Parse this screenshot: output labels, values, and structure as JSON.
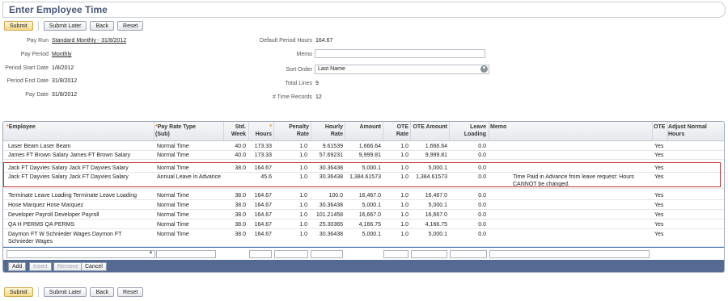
{
  "page_title": "Enter Employee Time",
  "buttons": {
    "submit": "Submit",
    "submit_later": "Submit Later",
    "back": "Back",
    "reset": "Reset"
  },
  "form_left": [
    {
      "label": "Pay Run",
      "value": "Standard Monthly - 31/8/2012"
    },
    {
      "label": "Pay Period",
      "value": "Monthly"
    },
    {
      "label": "Period Start Date",
      "value": "1/8/2012"
    },
    {
      "label": "Period End Date",
      "value": "31/8/2012"
    },
    {
      "label": "Pay Date",
      "value": "31/8/2012"
    }
  ],
  "form_right": {
    "default_hours_label": "Default Period Hours",
    "default_hours_value": "164.67",
    "memo_label": "Memo",
    "memo_value": "",
    "sort_order_label": "Sort Order",
    "sort_order_value": "Last Name",
    "total_lines_label": "Total Lines",
    "total_lines_value": "9",
    "time_records_label": "# Time Records",
    "time_records_value": "12"
  },
  "grid": {
    "headers": {
      "employee": "Employee",
      "pay_rate_type": "Pay Rate Type",
      "pay_rate_type_sub": "(Sub)",
      "std_week": "Std. Week",
      "hours": "Hours",
      "penalty_rate": "Penalty Rate",
      "hourly_rate": "Hourly Rate",
      "amount": "Amount",
      "ote_rate": "OTE Rate",
      "ote_amount": "OTE Amount",
      "leave_loading": "Leave Loading",
      "memo": "Memo",
      "ote": "OTE",
      "adjust": "Adjust Normal Hours"
    },
    "rows": [
      {
        "employee": "Laser Beam Laser Beam",
        "pay_rate_type": "Normal Time",
        "std_week": "40.0",
        "hours": "173.33",
        "penalty_rate": "1.0",
        "hourly_rate": "9.61539",
        "amount": "1,666.64",
        "ote_rate": "1.0",
        "ote_amount": "1,666.64",
        "leave_loading": "0.0",
        "memo": "",
        "ote": "Yes"
      },
      {
        "employee": "James FT Brown Salary James FT Brown Salary",
        "pay_rate_type": "Normal Time",
        "std_week": "40.0",
        "hours": "173.33",
        "penalty_rate": "1.0",
        "hourly_rate": "57.69231",
        "amount": "9,999.81",
        "ote_rate": "1.0",
        "ote_amount": "9,999.81",
        "leave_loading": "0.0",
        "memo": "",
        "ote": "Yes"
      },
      {
        "employee": "Jack FT Dayvies Salary Jack FT Dayvies Salary",
        "pay_rate_type": "Normal Time",
        "std_week": "38.0",
        "hours": "164.67",
        "penalty_rate": "1.0",
        "hourly_rate": "30.36438",
        "amount": "5,000.1",
        "ote_rate": "1.0",
        "ote_amount": "5,000.1",
        "leave_loading": "0.0",
        "memo": "",
        "ote": "Yes"
      },
      {
        "employee": "Jack FT Dayvies Salary Jack FT Dayvies Salary",
        "pay_rate_type": "Annual Leave in Advance",
        "std_week": "",
        "hours": "45.6",
        "penalty_rate": "1.0",
        "hourly_rate": "30.36438",
        "amount": "1,384.61573",
        "ote_rate": "1.0",
        "ote_amount": "1,384.61573",
        "leave_loading": "0.0",
        "memo": "Time Paid in Advance from leave request: Hours CANNOT be changed.",
        "ote": "Yes"
      },
      {
        "employee": "Terminate Leave Loading Terminate Leave Loading",
        "pay_rate_type": "Normal Time",
        "std_week": "38.0",
        "hours": "164.67",
        "penalty_rate": "1.0",
        "hourly_rate": "100.0",
        "amount": "16,467.0",
        "ote_rate": "1.0",
        "ote_amount": "16,467.0",
        "leave_loading": "0.0",
        "memo": "",
        "ote": "Yes"
      },
      {
        "employee": "Hose Marquez Hose Marquez",
        "pay_rate_type": "Normal Time",
        "std_week": "38.0",
        "hours": "164.67",
        "penalty_rate": "1.0",
        "hourly_rate": "30.36438",
        "amount": "5,000.1",
        "ote_rate": "1.0",
        "ote_amount": "5,000.1",
        "leave_loading": "0.0",
        "memo": "",
        "ote": "Yes"
      },
      {
        "employee": "Developer Payroll Developer Payroll",
        "pay_rate_type": "Normal Time",
        "std_week": "38.0",
        "hours": "164.67",
        "penalty_rate": "1.0",
        "hourly_rate": "101.21458",
        "amount": "16,667.0",
        "ote_rate": "1.0",
        "ote_amount": "16,667.0",
        "leave_loading": "0.0",
        "memo": "",
        "ote": "Yes"
      },
      {
        "employee": "QA H PERMS QA PERMS",
        "pay_rate_type": "Normal Time",
        "std_week": "38.0",
        "hours": "164.67",
        "penalty_rate": "1.0",
        "hourly_rate": "25.30365",
        "amount": "4,166.75",
        "ote_rate": "1.0",
        "ote_amount": "4,166.75",
        "leave_loading": "0.0",
        "memo": "",
        "ote": "Yes"
      },
      {
        "employee": "Daymon FT W Schnieder Wages Daymon FT Schnieder Wages",
        "pay_rate_type": "Normal Time",
        "std_week": "38.0",
        "hours": "164.67",
        "penalty_rate": "1.0",
        "hourly_rate": "30.36438",
        "amount": "5,000.1",
        "ote_rate": "1.0",
        "ote_amount": "5,000.1",
        "leave_loading": "0.0",
        "memo": "",
        "ote": "Yes"
      }
    ],
    "actions": {
      "add": "Add",
      "insert": "Insert",
      "remove": "Remove",
      "cancel": "Cancel"
    }
  },
  "icons": {
    "dropdown": "chevron-down-icon",
    "required": "asterisk-icon"
  },
  "colors": {
    "title": "#4a5a7a",
    "primary_button": "#f6d98a",
    "highlight_border": "#c0393b",
    "action_bar": "#556a92",
    "edit_row_border": "#3c6fb6"
  }
}
